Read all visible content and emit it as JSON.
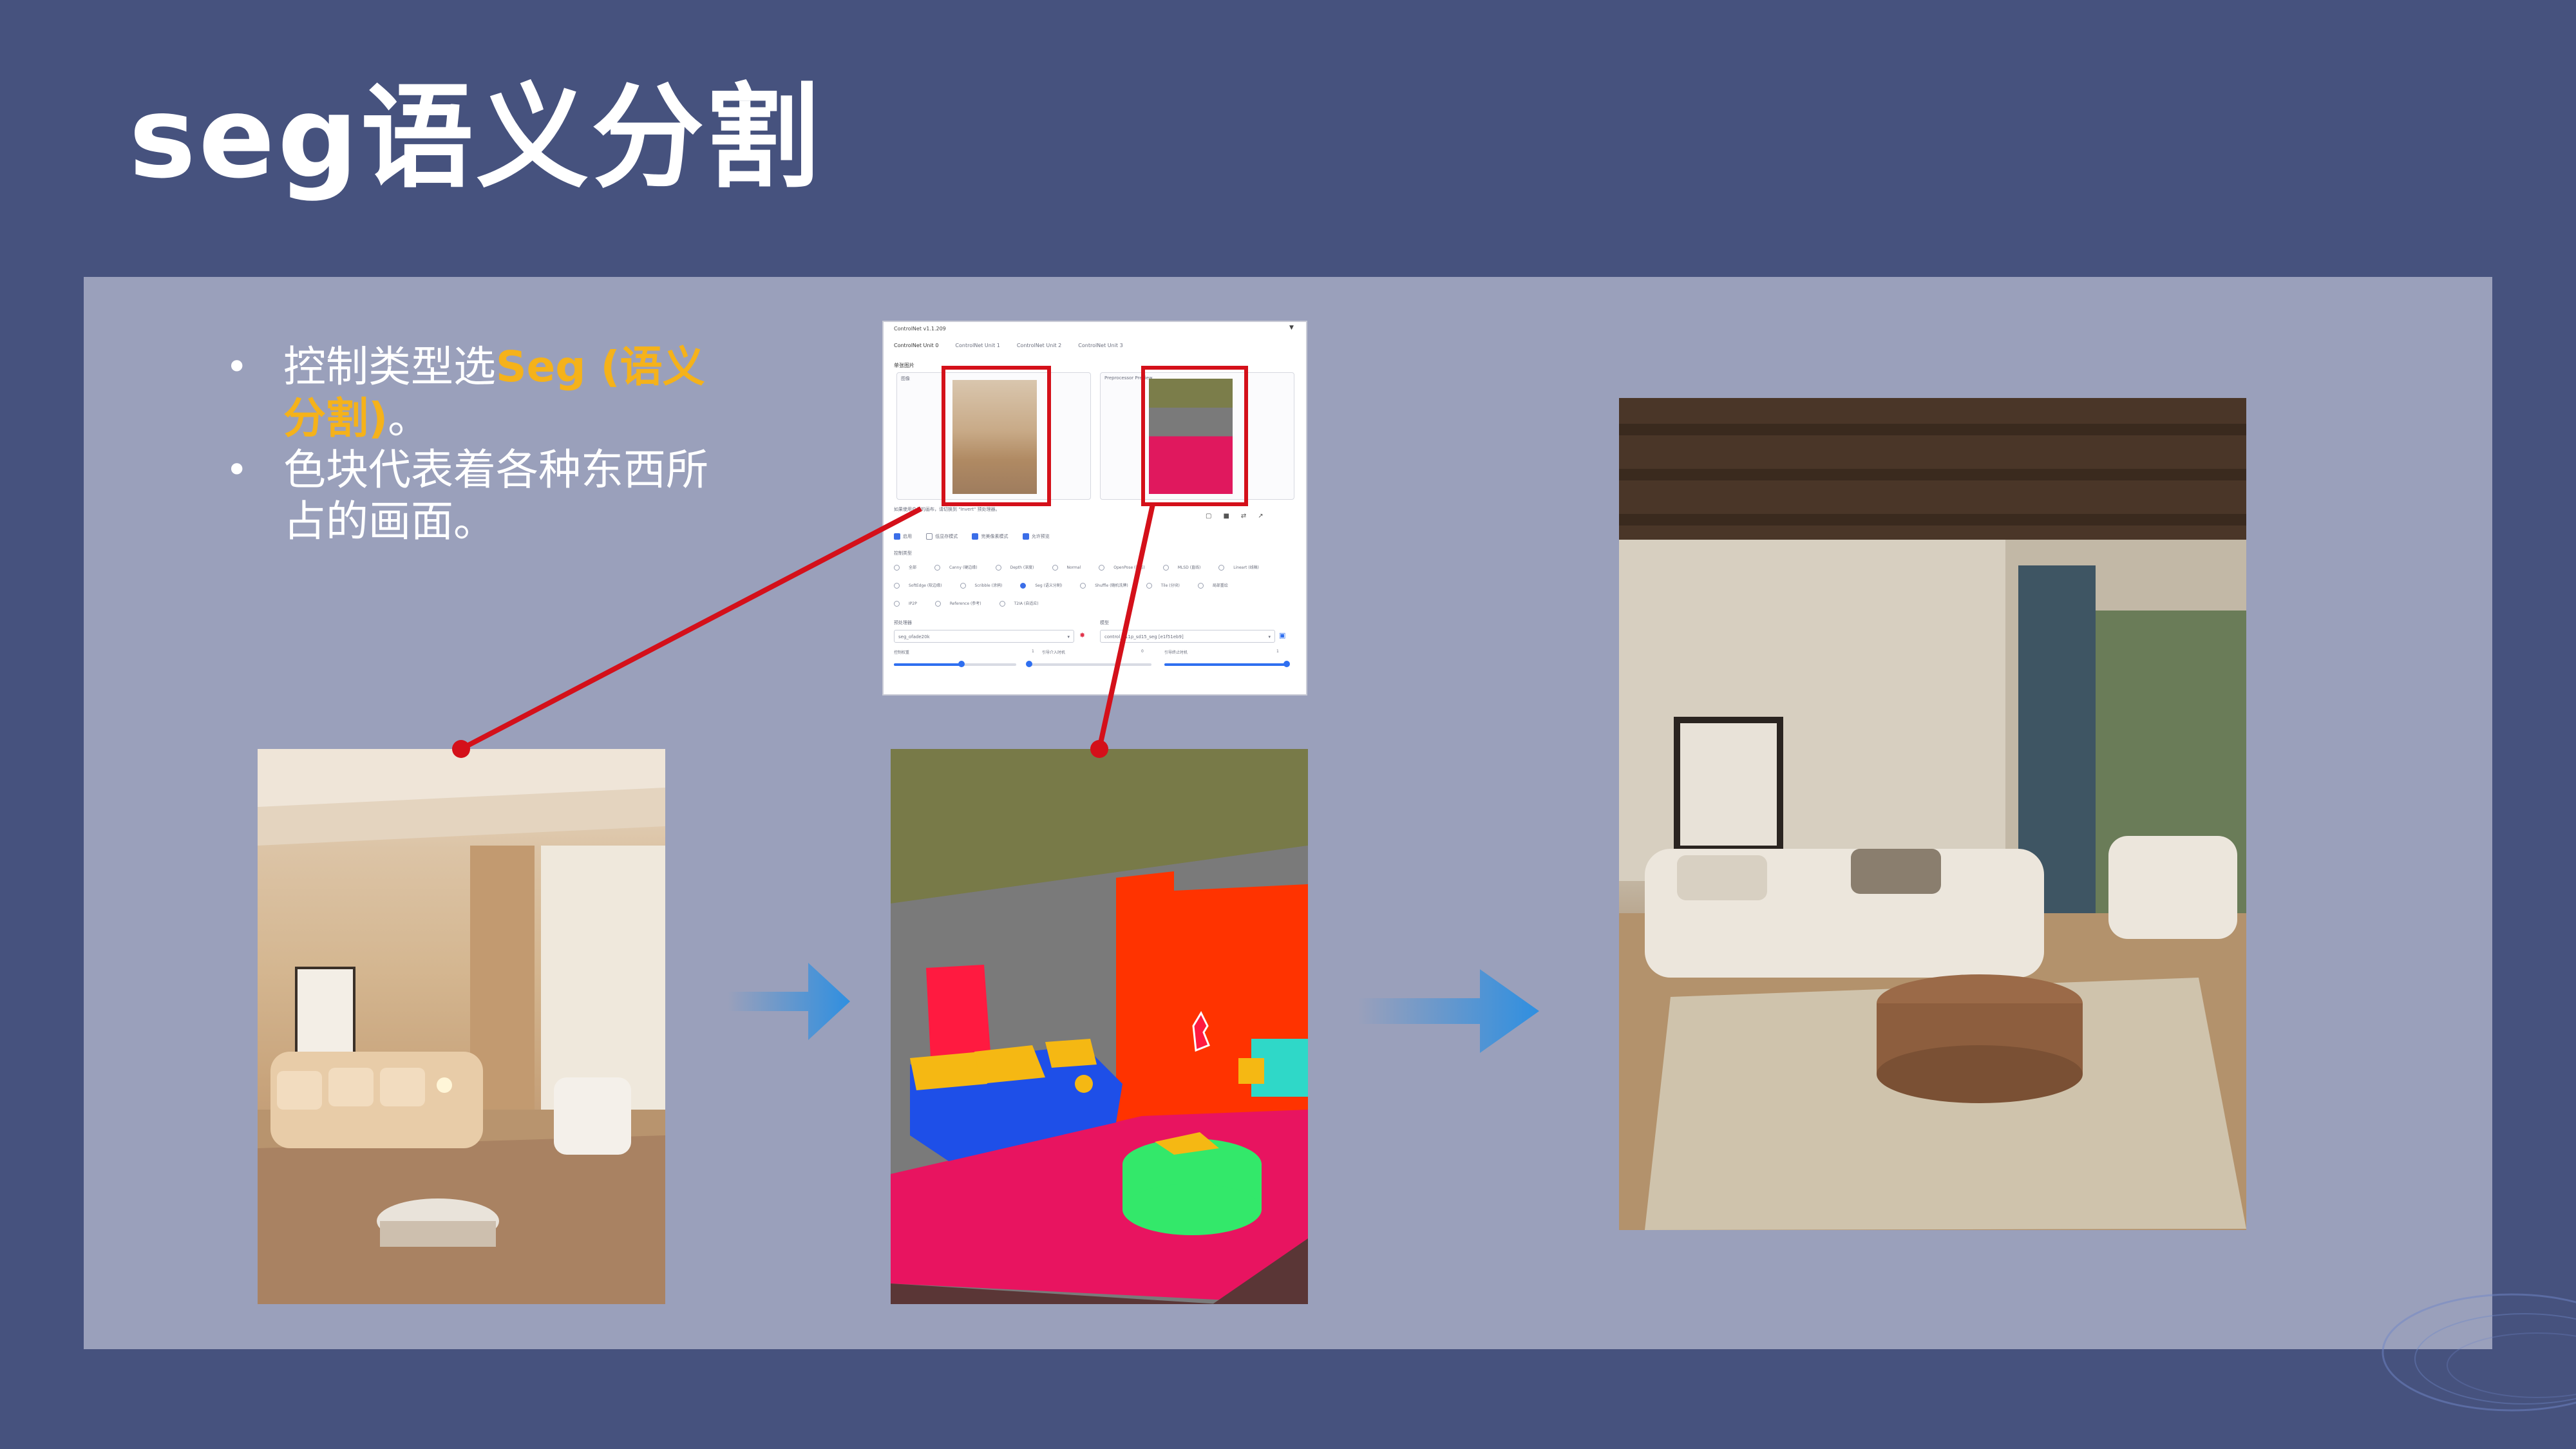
{
  "slide": {
    "title": "seg语义分割",
    "bullets": [
      {
        "prefix": "控制类型选",
        "highlight": "Seg (语义分割)",
        "suffix": "。"
      },
      {
        "prefix": "色块代表着各种东西所占的画面。",
        "highlight": "",
        "suffix": ""
      }
    ],
    "bullet_mark": "•"
  },
  "controlnet": {
    "version": "ControlNet v1.1.209",
    "collapse_icon": "▼",
    "tabs": [
      "ControlNet Unit 0",
      "ControlNet Unit 1",
      "ControlNet Unit 2",
      "ControlNet Unit 3"
    ],
    "single_image_label": "单张图片",
    "image_tab_label": "图像",
    "preview_label": "Preprocessor Preview",
    "hint_text": "如果使用白色的画布，请切换到 \"Invert\" 预处理器。",
    "checkboxes": [
      {
        "label": "启用",
        "checked": true
      },
      {
        "label": "低显存模式",
        "checked": false
      },
      {
        "label": "完美像素模式",
        "checked": true
      },
      {
        "label": "允许预览",
        "checked": true
      }
    ],
    "control_type_label": "控制类型",
    "control_types": [
      {
        "label": "全部",
        "selected": false
      },
      {
        "label": "Canny (硬边缘)",
        "selected": false
      },
      {
        "label": "Depth (深度)",
        "selected": false
      },
      {
        "label": "Normal",
        "selected": false
      },
      {
        "label": "OpenPose (姿态)",
        "selected": false
      },
      {
        "label": "MLSD (直线)",
        "selected": false
      },
      {
        "label": "Lineart (线稿)",
        "selected": false
      },
      {
        "label": "SoftEdge (软边缘)",
        "selected": false
      },
      {
        "label": "Scribble (涂鸦)",
        "selected": false
      },
      {
        "label": "Seg (语义分割)",
        "selected": true
      },
      {
        "label": "Shuffle (随机洗牌)",
        "selected": false
      },
      {
        "label": "Tile (分块)",
        "selected": false
      },
      {
        "label": "局部重绘",
        "selected": false
      },
      {
        "label": "IP2P",
        "selected": false
      },
      {
        "label": "Reference (参考)",
        "selected": false
      },
      {
        "label": "T2IA (自适应)",
        "selected": false
      }
    ],
    "preprocessor_label": "预处理器",
    "preprocessor_value": "seg_ofade20k",
    "model_label": "模型",
    "model_value": "control_v11p_sd15_seg [e1f51eb9]",
    "sliders": [
      {
        "label": "控制权重",
        "value": "1",
        "fraction": 0.55
      },
      {
        "label": "引导介入时机",
        "value": "0",
        "fraction": 0.0
      },
      {
        "label": "引导终止时机",
        "value": "1",
        "fraction": 1.0
      }
    ],
    "tool_icons": [
      "new-canvas-icon",
      "camera-icon",
      "swap-icon",
      "send-icon"
    ]
  },
  "colors": {
    "background": "#46527e",
    "panel": "#9aa0bb",
    "highlight": "#f5b21a",
    "annotation": "#d4101a",
    "arrow": "#2f8fe0",
    "seg_ceiling": "#787a48",
    "seg_wall": "#7a7a7a",
    "seg_red": "#ff3300",
    "seg_sofa": "#1e4fe8",
    "seg_cushion": "#f5b813",
    "seg_rug": "#e81460",
    "seg_table": "#33e86a",
    "seg_chair": "#2fd8c8",
    "seg_floor": "#5a3636"
  },
  "images": {
    "input_photo": "beige-living-room-photo",
    "segmentation_map": "seg-color-map",
    "output_photo": "sunlit-living-room-render"
  }
}
